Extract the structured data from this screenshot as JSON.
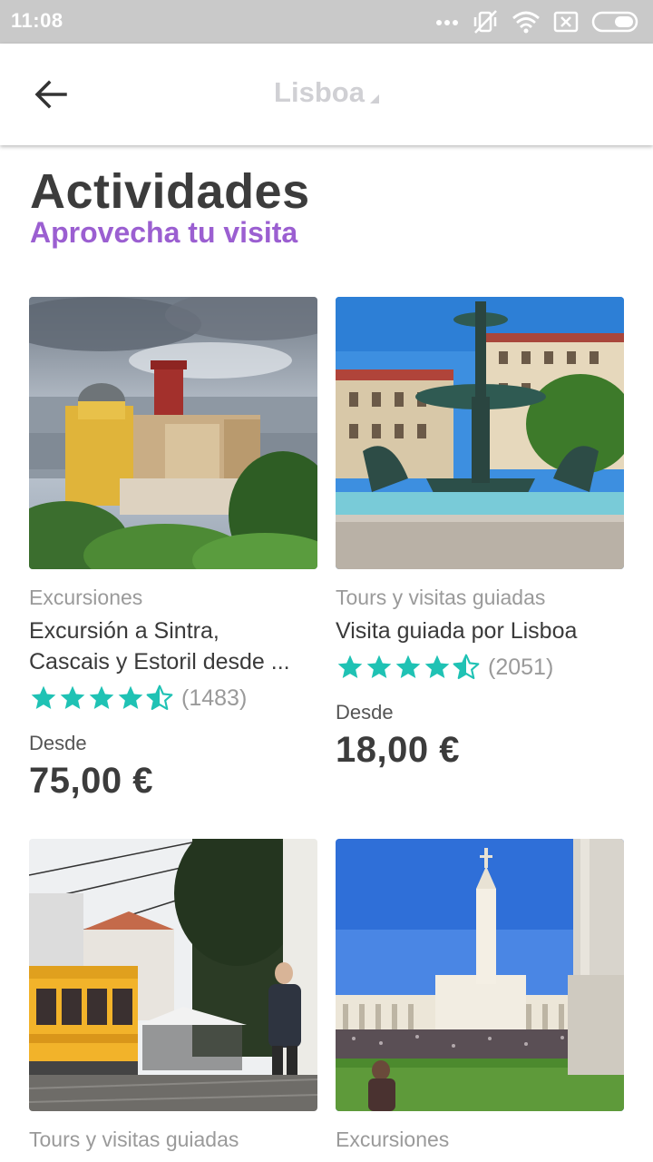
{
  "status_bar": {
    "time": "11:08",
    "icons": [
      "more-dots-icon",
      "vibrate-off-icon",
      "wifi-icon",
      "sim-off-icon",
      "battery-icon"
    ]
  },
  "app_bar": {
    "title": "Lisboa",
    "back_icon": "arrow-back-icon"
  },
  "header": {
    "title": "Actividades",
    "subtitle": "Aprovecha tu visita"
  },
  "colors": {
    "accent": "#9b5fd1",
    "star": "#1fc2b4",
    "text_dark": "#3c3c3c",
    "text_muted": "#9a9a9a",
    "status_bar": "#c9c9c9"
  },
  "activities": [
    {
      "category": "Excursiones",
      "name_line1": "Excursión a Sintra,",
      "name_line2": "Cascais y Estoril desde ...",
      "rating": 4.5,
      "reviews": "(1483)",
      "price_label": "Desde",
      "price": "75,00 €",
      "image": "sintra-pena-palace-photo"
    },
    {
      "category": "Tours y visitas guiadas",
      "name_line1": "Visita guiada por Lisboa",
      "rating": 4.5,
      "reviews": "(2051)",
      "price_label": "Desde",
      "price": "18,00 €",
      "image": "lisbon-fountain-photo"
    },
    {
      "category": "Tours y visitas guiadas",
      "image": "lisbon-tram-photo"
    },
    {
      "category": "Excursiones",
      "image": "fatima-sanctuary-photo"
    }
  ]
}
